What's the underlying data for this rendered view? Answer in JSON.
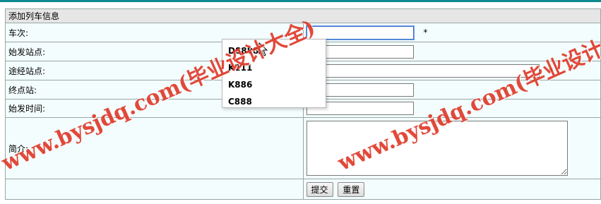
{
  "form": {
    "title": "添加列车信息",
    "fields": {
      "train_no": {
        "label": "车次:",
        "value": "",
        "required_mark": "*"
      },
      "start_station": {
        "label": "始发站点:",
        "value": ""
      },
      "via_station": {
        "label": "途经站点:",
        "value": "",
        "required_mark": "*"
      },
      "end_station": {
        "label": "终点站:",
        "value": ""
      },
      "depart_time": {
        "label": "始发时间:",
        "value": ""
      },
      "intro": {
        "label": "简介:",
        "value": ""
      }
    },
    "buttons": {
      "submit": "提交",
      "reset": "重置"
    }
  },
  "autocomplete": {
    "options": [
      "D8888",
      "K111",
      "K886",
      "C888"
    ]
  },
  "watermark": {
    "text": "www.bysjdq.com(毕业设计大全)"
  },
  "colors": {
    "top_bar": "#0d8a8e",
    "header_bg": "#e6e6e6",
    "row_bg": "#f3fdfd",
    "border": "#9aa6a6",
    "watermark": "#e03a2a"
  }
}
